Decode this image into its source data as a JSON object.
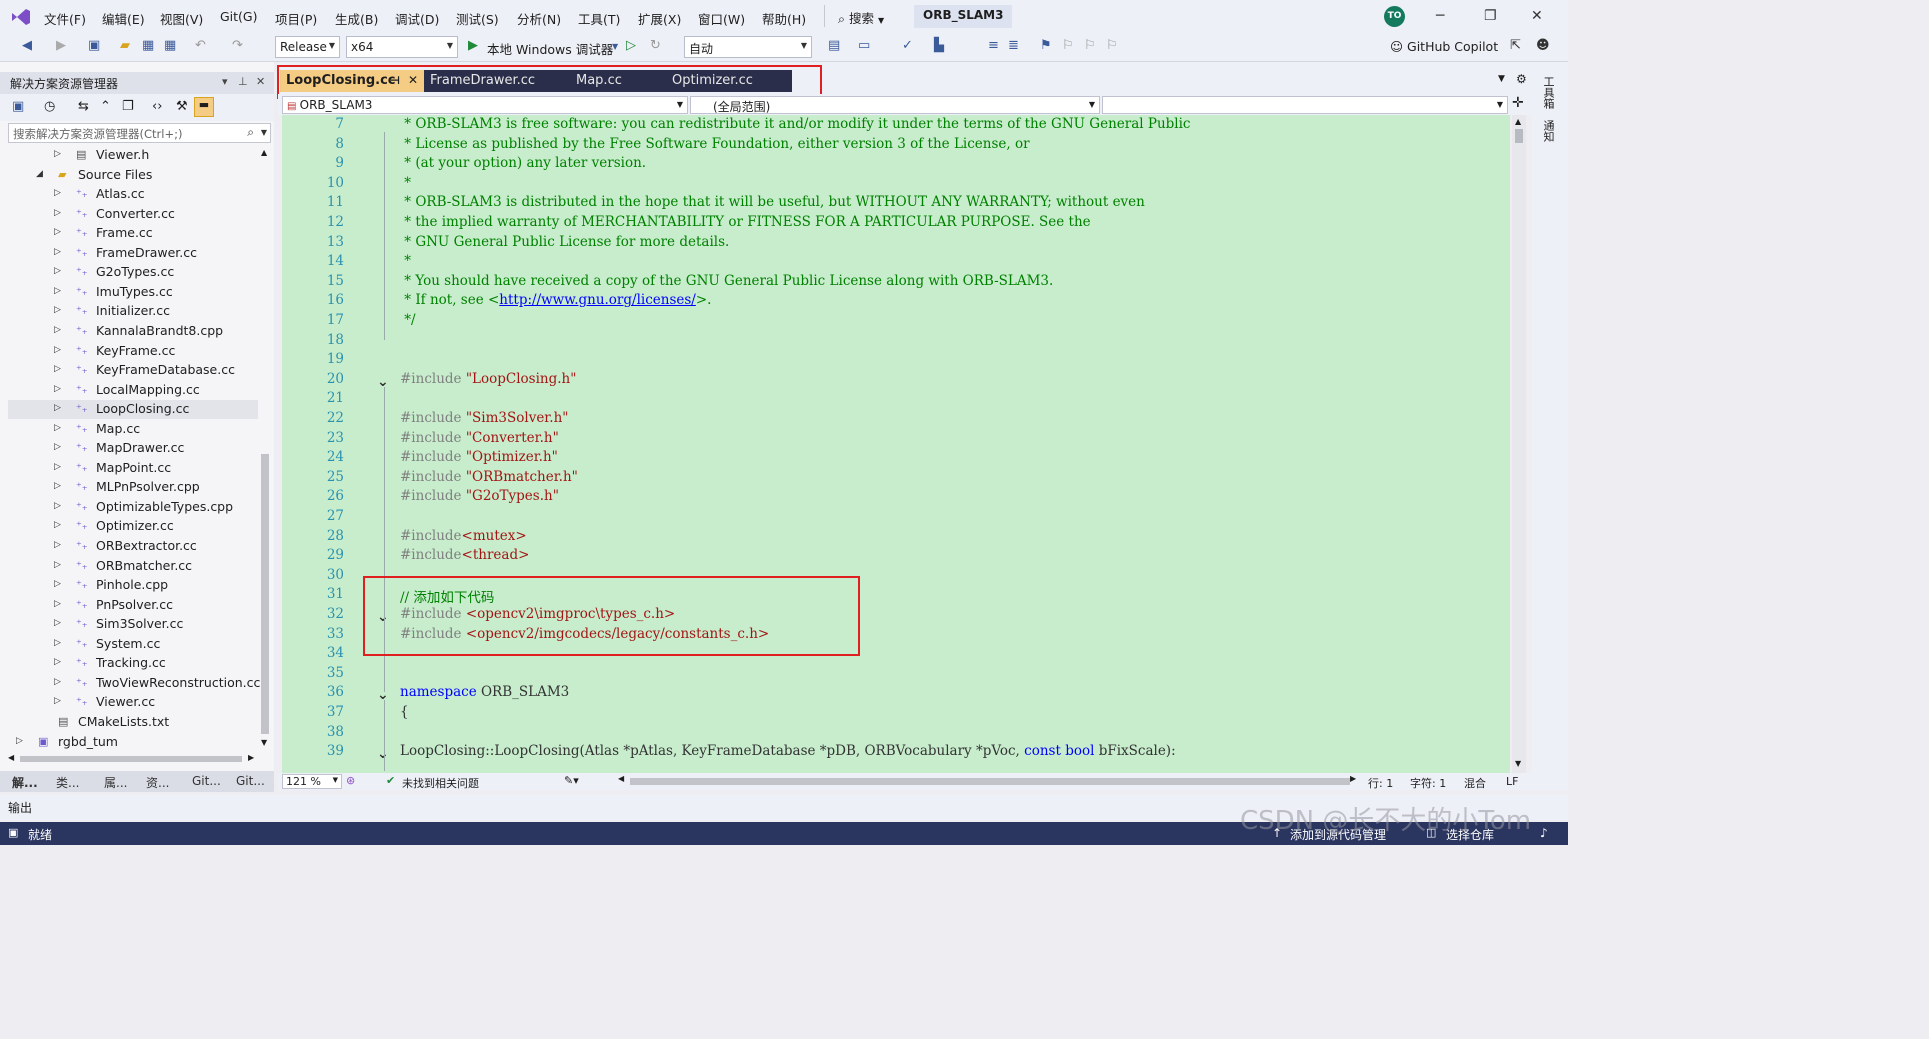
{
  "menubar": {
    "items": [
      "文件(F)",
      "编辑(E)",
      "视图(V)",
      "Git(G)",
      "项目(P)",
      "生成(B)",
      "调试(D)",
      "测试(S)",
      "分析(N)",
      "工具(T)",
      "扩展(X)",
      "窗口(W)",
      "帮助(H)"
    ],
    "search_label": "搜索",
    "solution_name": "ORB_SLAM3",
    "avatar_initials": "TO"
  },
  "toolbar": {
    "config": "Release",
    "platform": "x64",
    "debugger_label": "本地 Windows 调试器",
    "auto_label": "自动",
    "copilot_label": "GitHub Copilot"
  },
  "solution_explorer": {
    "title": "解决方案资源管理器",
    "search_placeholder": "搜索解决方案资源管理器(Ctrl+;)",
    "items": [
      {
        "label": "Viewer.h",
        "indent": 2,
        "icon": "header-file-icon",
        "expander": "collapsed"
      },
      {
        "label": "Source Files",
        "indent": 1,
        "icon": "folder-icon",
        "expander": "expanded"
      },
      {
        "label": "Atlas.cc",
        "indent": 2,
        "icon": "cpp-file-icon",
        "expander": "collapsed"
      },
      {
        "label": "Converter.cc",
        "indent": 2,
        "icon": "cpp-file-icon",
        "expander": "collapsed"
      },
      {
        "label": "Frame.cc",
        "indent": 2,
        "icon": "cpp-file-icon",
        "expander": "collapsed"
      },
      {
        "label": "FrameDrawer.cc",
        "indent": 2,
        "icon": "cpp-file-icon",
        "expander": "collapsed"
      },
      {
        "label": "G2oTypes.cc",
        "indent": 2,
        "icon": "cpp-file-icon",
        "expander": "collapsed"
      },
      {
        "label": "ImuTypes.cc",
        "indent": 2,
        "icon": "cpp-file-icon",
        "expander": "collapsed"
      },
      {
        "label": "Initializer.cc",
        "indent": 2,
        "icon": "cpp-file-icon",
        "expander": "collapsed"
      },
      {
        "label": "KannalaBrandt8.cpp",
        "indent": 2,
        "icon": "cpp-file-icon",
        "expander": "collapsed"
      },
      {
        "label": "KeyFrame.cc",
        "indent": 2,
        "icon": "cpp-file-icon",
        "expander": "collapsed"
      },
      {
        "label": "KeyFrameDatabase.cc",
        "indent": 2,
        "icon": "cpp-file-icon",
        "expander": "collapsed"
      },
      {
        "label": "LocalMapping.cc",
        "indent": 2,
        "icon": "cpp-file-icon",
        "expander": "collapsed"
      },
      {
        "label": "LoopClosing.cc",
        "indent": 2,
        "icon": "cpp-file-icon",
        "expander": "collapsed",
        "selected": true
      },
      {
        "label": "Map.cc",
        "indent": 2,
        "icon": "cpp-file-icon",
        "expander": "collapsed"
      },
      {
        "label": "MapDrawer.cc",
        "indent": 2,
        "icon": "cpp-file-icon",
        "expander": "collapsed"
      },
      {
        "label": "MapPoint.cc",
        "indent": 2,
        "icon": "cpp-file-icon",
        "expander": "collapsed"
      },
      {
        "label": "MLPnPsolver.cpp",
        "indent": 2,
        "icon": "cpp-file-icon",
        "expander": "collapsed"
      },
      {
        "label": "OptimizableTypes.cpp",
        "indent": 2,
        "icon": "cpp-file-icon",
        "expander": "collapsed"
      },
      {
        "label": "Optimizer.cc",
        "indent": 2,
        "icon": "cpp-file-icon",
        "expander": "collapsed"
      },
      {
        "label": "ORBextractor.cc",
        "indent": 2,
        "icon": "cpp-file-icon",
        "expander": "collapsed"
      },
      {
        "label": "ORBmatcher.cc",
        "indent": 2,
        "icon": "cpp-file-icon",
        "expander": "collapsed"
      },
      {
        "label": "Pinhole.cpp",
        "indent": 2,
        "icon": "cpp-file-icon",
        "expander": "collapsed"
      },
      {
        "label": "PnPsolver.cc",
        "indent": 2,
        "icon": "cpp-file-icon",
        "expander": "collapsed"
      },
      {
        "label": "Sim3Solver.cc",
        "indent": 2,
        "icon": "cpp-file-icon",
        "expander": "collapsed"
      },
      {
        "label": "System.cc",
        "indent": 2,
        "icon": "cpp-file-icon",
        "expander": "collapsed"
      },
      {
        "label": "Tracking.cc",
        "indent": 2,
        "icon": "cpp-file-icon",
        "expander": "collapsed"
      },
      {
        "label": "TwoViewReconstruction.cc",
        "indent": 2,
        "icon": "cpp-file-icon",
        "expander": "collapsed"
      },
      {
        "label": "Viewer.cc",
        "indent": 2,
        "icon": "cpp-file-icon",
        "expander": "collapsed"
      },
      {
        "label": "CMakeLists.txt",
        "indent": 1,
        "icon": "text-file-icon",
        "expander": "none"
      },
      {
        "label": "rgbd_tum",
        "indent": 0,
        "icon": "project-icon",
        "expander": "collapsed"
      }
    ],
    "bottom_tabs": [
      "解...",
      "类...",
      "属...",
      "资...",
      "Git...",
      "Git..."
    ]
  },
  "editor": {
    "tabs": [
      {
        "label": "LoopClosing.cc",
        "active": true
      },
      {
        "label": "FrameDrawer.cc",
        "active": false
      },
      {
        "label": "Map.cc",
        "active": false
      },
      {
        "label": "Optimizer.cc",
        "active": false
      }
    ],
    "nav_project": "ORB_SLAM3",
    "nav_scope": "(全局范围)",
    "zoom": "121 %",
    "issues": "未找到相关问题",
    "line": "行: 1",
    "char": "字符: 1",
    "mixed": "混合",
    "eol": "LF"
  },
  "code_lines": [
    {
      "n": 7,
      "fold": "",
      "parts": [
        [
          "c-com",
          " * ORB-SLAM3 is free software: you can redistribute it and/or modify it under the terms of the GNU General Public"
        ]
      ]
    },
    {
      "n": 8,
      "fold": "",
      "parts": [
        [
          "c-com",
          " * License as published by the Free Software Foundation, either version 3 of the License, or"
        ]
      ]
    },
    {
      "n": 9,
      "fold": "",
      "parts": [
        [
          "c-com",
          " * (at your option) any later version."
        ]
      ]
    },
    {
      "n": 10,
      "fold": "",
      "parts": [
        [
          "c-com",
          " *"
        ]
      ]
    },
    {
      "n": 11,
      "fold": "",
      "parts": [
        [
          "c-com",
          " * ORB-SLAM3 is distributed in the hope that it will be useful, but WITHOUT ANY WARRANTY; without even"
        ]
      ]
    },
    {
      "n": 12,
      "fold": "",
      "parts": [
        [
          "c-com",
          " * the implied warranty of MERCHANTABILITY or FITNESS FOR A PARTICULAR PURPOSE. See the"
        ]
      ]
    },
    {
      "n": 13,
      "fold": "",
      "parts": [
        [
          "c-com",
          " * GNU General Public License for more details."
        ]
      ]
    },
    {
      "n": 14,
      "fold": "",
      "parts": [
        [
          "c-com",
          " *"
        ]
      ]
    },
    {
      "n": 15,
      "fold": "",
      "parts": [
        [
          "c-com",
          " * You should have received a copy of the GNU General Public License along with ORB-SLAM3."
        ]
      ]
    },
    {
      "n": 16,
      "fold": "",
      "parts": [
        [
          "c-com",
          " * If not, see <"
        ],
        [
          "c-link",
          "http://www.gnu.org/licenses/"
        ],
        [
          "c-com",
          ">."
        ]
      ]
    },
    {
      "n": 17,
      "fold": "",
      "parts": [
        [
          "c-com",
          " */"
        ]
      ]
    },
    {
      "n": 18,
      "fold": "",
      "parts": []
    },
    {
      "n": 19,
      "fold": "",
      "parts": []
    },
    {
      "n": 20,
      "fold": "v",
      "parts": [
        [
          "c-pre",
          "#include "
        ],
        [
          "c-str",
          "\"LoopClosing.h\""
        ]
      ]
    },
    {
      "n": 21,
      "fold": "",
      "parts": []
    },
    {
      "n": 22,
      "fold": "",
      "parts": [
        [
          "c-pre",
          "#include "
        ],
        [
          "c-str",
          "\"Sim3Solver.h\""
        ]
      ]
    },
    {
      "n": 23,
      "fold": "",
      "parts": [
        [
          "c-pre",
          "#include "
        ],
        [
          "c-str",
          "\"Converter.h\""
        ]
      ]
    },
    {
      "n": 24,
      "fold": "",
      "parts": [
        [
          "c-pre",
          "#include "
        ],
        [
          "c-str",
          "\"Optimizer.h\""
        ]
      ]
    },
    {
      "n": 25,
      "fold": "",
      "parts": [
        [
          "c-pre",
          "#include "
        ],
        [
          "c-str",
          "\"ORBmatcher.h\""
        ]
      ]
    },
    {
      "n": 26,
      "fold": "",
      "parts": [
        [
          "c-pre",
          "#include "
        ],
        [
          "c-str",
          "\"G2oTypes.h\""
        ]
      ]
    },
    {
      "n": 27,
      "fold": "",
      "parts": []
    },
    {
      "n": 28,
      "fold": "",
      "parts": [
        [
          "c-pre",
          "#include"
        ],
        [
          "c-ang",
          "<mutex>"
        ]
      ]
    },
    {
      "n": 29,
      "fold": "",
      "parts": [
        [
          "c-pre",
          "#include"
        ],
        [
          "c-ang",
          "<thread>"
        ]
      ]
    },
    {
      "n": 30,
      "fold": "",
      "parts": []
    },
    {
      "n": 31,
      "fold": "",
      "parts": [
        [
          "c-com",
          "// 添加如下代码"
        ]
      ]
    },
    {
      "n": 32,
      "fold": "v",
      "parts": [
        [
          "c-pre",
          "#include "
        ],
        [
          "c-ang",
          "<opencv2\\imgproc\\types_c.h>"
        ]
      ]
    },
    {
      "n": 33,
      "fold": "",
      "parts": [
        [
          "c-pre",
          "#include "
        ],
        [
          "c-ang",
          "<opencv2/imgcodecs/legacy/constants_c.h>"
        ]
      ]
    },
    {
      "n": 34,
      "fold": "",
      "parts": []
    },
    {
      "n": 35,
      "fold": "",
      "parts": []
    },
    {
      "n": 36,
      "fold": "v",
      "parts": [
        [
          "c-kw",
          "namespace"
        ],
        [
          "",
          " ORB_SLAM3"
        ]
      ]
    },
    {
      "n": 37,
      "fold": "",
      "parts": [
        [
          "",
          "{"
        ]
      ]
    },
    {
      "n": 38,
      "fold": "",
      "parts": []
    },
    {
      "n": 39,
      "fold": "v",
      "parts": [
        [
          "",
          "LoopClosing::LoopClosing(Atlas *pAtlas, KeyFrameDatabase *pDB, ORBVocabulary *pVoc, "
        ],
        [
          "c-kw",
          "const"
        ],
        [
          "",
          " "
        ],
        [
          "c-kw",
          "bool"
        ],
        [
          "",
          " bFixScale):"
        ]
      ]
    }
  ],
  "output_label": "输出",
  "status": {
    "ready": "就绪",
    "add_source": "添加到源代码管理",
    "select_repo": "选择仓库"
  },
  "watermark": "CSDN @长不大的小Tom",
  "colors": {
    "editor_bg": "#c7edcc",
    "active_tab": "#f5cc84",
    "highlight_box": "#e02020",
    "status_bar": "#2a3560"
  }
}
